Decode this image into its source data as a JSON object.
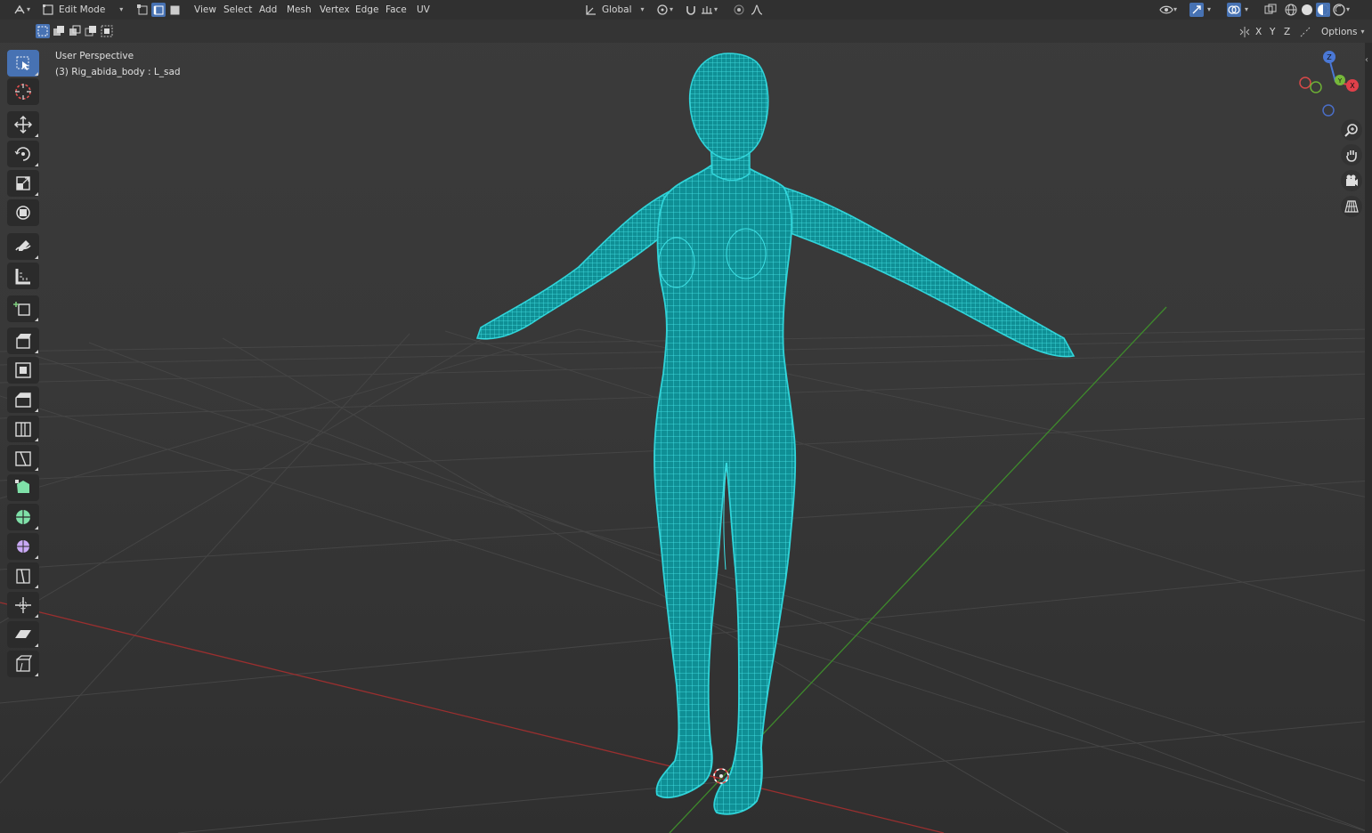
{
  "header": {
    "mode": "Edit Mode",
    "menus": [
      "View",
      "Select",
      "Add",
      "Mesh",
      "Vertex",
      "Edge",
      "Face",
      "UV"
    ],
    "transform_orientation": "Global",
    "select_modes": [
      "vertex",
      "edge",
      "face"
    ],
    "active_select_mode": "edge"
  },
  "tool_header": {
    "axes": [
      "X",
      "Y",
      "Z"
    ],
    "options_label": "Options"
  },
  "overlay": {
    "view_name": "User Perspective",
    "object_info": "(3) Rig_abida_body : L_sad"
  },
  "gizmo": {
    "x": "X",
    "y": "Y",
    "z": "Z"
  },
  "toolbar": {
    "tools": [
      {
        "name": "select-box",
        "active": true
      },
      {
        "name": "cursor"
      },
      {
        "name": "move"
      },
      {
        "name": "rotate"
      },
      {
        "name": "scale"
      },
      {
        "name": "transform"
      },
      {
        "name": "annotate"
      },
      {
        "name": "measure"
      },
      {
        "name": "add-cube"
      },
      {
        "name": "extrude-region"
      },
      {
        "name": "inset-faces"
      },
      {
        "name": "bevel"
      },
      {
        "name": "loop-cut"
      },
      {
        "name": "knife"
      },
      {
        "name": "poly-build"
      },
      {
        "name": "spin"
      },
      {
        "name": "smooth"
      },
      {
        "name": "edge-slide"
      },
      {
        "name": "shrink-fatten"
      },
      {
        "name": "shear"
      },
      {
        "name": "rip-region"
      }
    ]
  },
  "colors": {
    "mesh_wire": "#2fd3d8",
    "mesh_fill": "#0e8d93",
    "x_axis": "#9a2f2f",
    "y_axis": "#3e8a2c",
    "accent": "#4772b3",
    "gizmo_x": "#e0404a",
    "gizmo_y": "#76b83a",
    "gizmo_z": "#4a78d6"
  },
  "right_nav": [
    "zoom-icon",
    "pan-hand-icon",
    "camera-icon",
    "grid-view-icon"
  ]
}
